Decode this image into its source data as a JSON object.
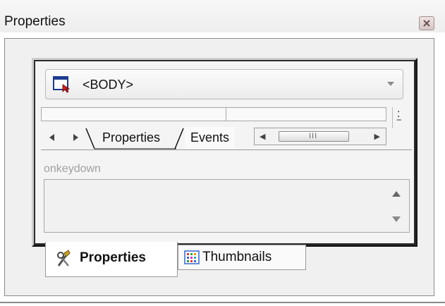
{
  "window": {
    "title": "Properties"
  },
  "element_selector": {
    "value": "<BODY>"
  },
  "inner_tabs": {
    "properties": "Properties",
    "events": "Events"
  },
  "scroll_grip": "III",
  "event": {
    "name": "onkeydown"
  },
  "bottom_tabs": {
    "properties": "Properties",
    "thumbnails": "Thumbnails"
  },
  "icons": [
    "close-icon",
    "element-icon",
    "dropdown-arrow-icon",
    "arrow-left-icon",
    "arrow-right-icon",
    "scroll-up-icon",
    "scroll-down-icon",
    "tools-icon",
    "thumbnails-grid-icon"
  ]
}
